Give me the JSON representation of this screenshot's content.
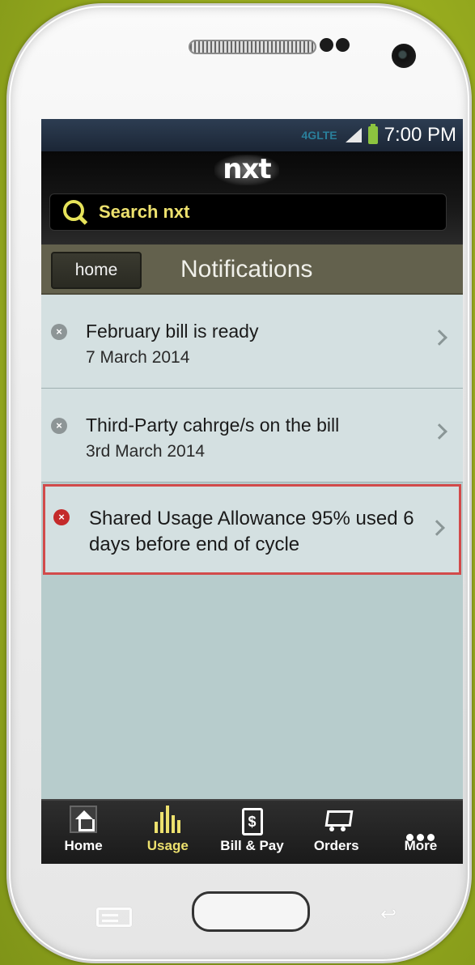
{
  "status_bar": {
    "network": "4G",
    "network_suffix": "LTE",
    "time": "7:00 PM"
  },
  "app": {
    "logo": "nxt"
  },
  "search": {
    "placeholder": "Search nxt"
  },
  "header": {
    "home_button": "home",
    "title": "Notifications"
  },
  "notifications": [
    {
      "title": "February bill is ready",
      "date": "7 March 2014",
      "status": "read",
      "icon": "x-circle-gray-icon"
    },
    {
      "title": "Third-Party cahrge/s on the bill",
      "date": "3rd March 2014",
      "status": "read",
      "icon": "x-circle-gray-icon"
    },
    {
      "title": "Shared Usage Allowance 95% used 6 days before end of cycle",
      "date": "",
      "status": "alert",
      "icon": "x-circle-red-icon"
    }
  ],
  "tabs": [
    {
      "label": "Home",
      "icon": "home-icon",
      "active": false
    },
    {
      "label": "Usage",
      "icon": "usage-bars-icon",
      "active": true
    },
    {
      "label": "Bill & Pay",
      "icon": "bill-icon",
      "active": false
    },
    {
      "label": "Orders",
      "icon": "cart-icon",
      "active": false
    },
    {
      "label": "More",
      "icon": "more-dots-icon",
      "active": false
    }
  ],
  "colors": {
    "accent": "#ede16e",
    "alert": "#d24a4a",
    "background": "#99ad1f"
  }
}
